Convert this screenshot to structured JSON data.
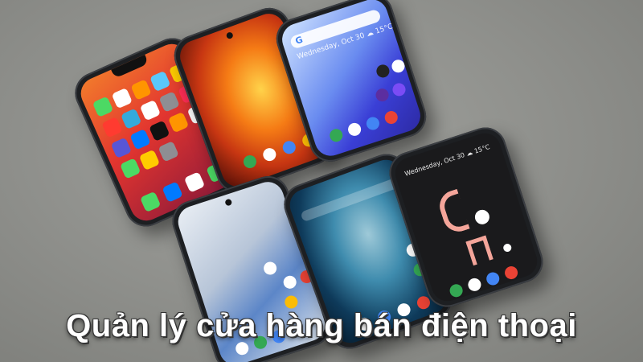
{
  "caption": "Quản lý cửa hàng bán điện thoại",
  "phones": {
    "status_date": "Wednesday, Oct 30  ☁ 15°C",
    "google_glyph": "G"
  },
  "colors": {
    "background": "#8f908c",
    "caption_text": "#ffffff"
  }
}
